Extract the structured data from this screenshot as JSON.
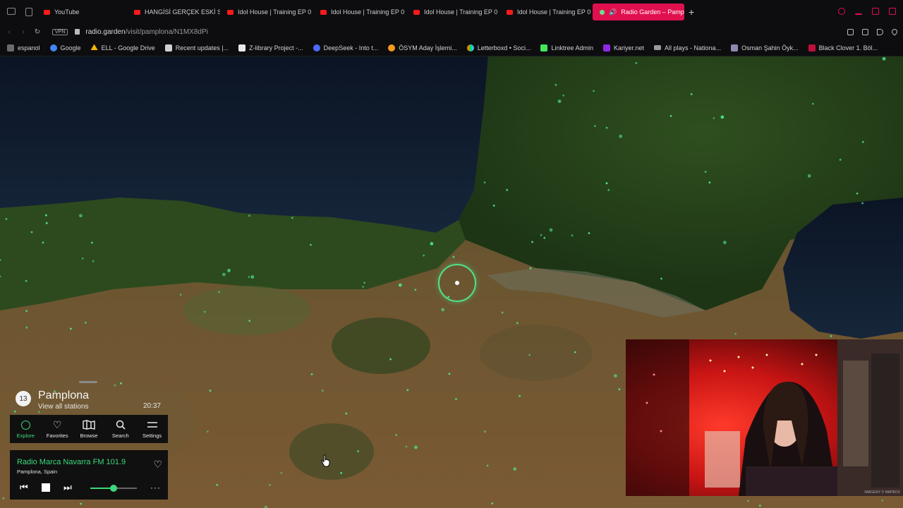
{
  "browser": {
    "tabs": [
      {
        "label": "YouTube",
        "icon": "youtube-icon"
      },
      {
        "label": "HANGİSİ GERÇEK ESKİ SE",
        "icon": "youtube-icon"
      },
      {
        "label": "Idol House | Training EP 0",
        "icon": "youtube-icon"
      },
      {
        "label": "Idol House | Training EP 0",
        "icon": "youtube-icon"
      },
      {
        "label": "Idol House | Training EP 0",
        "icon": "youtube-icon"
      },
      {
        "label": "Idol House | Training EP 0",
        "icon": "youtube-icon"
      },
      {
        "label": "Radio Garden – Pampl",
        "icon": "radio-garden-icon",
        "active": true
      }
    ],
    "vpn_label": "VPN",
    "url_host": "radio.garden",
    "url_path": "/visit/pamplona/N1MX8dPi",
    "bookmarks": [
      {
        "label": "espanol",
        "color": "#6b6b6b"
      },
      {
        "label": "Google",
        "color": "#4285f4"
      },
      {
        "label": "ELL - Google Drive",
        "color": "#f4b400"
      },
      {
        "label": "Recent updates |...",
        "color": "#d0d0d0"
      },
      {
        "label": "Z-library Project -...",
        "color": "#e9e9e9"
      },
      {
        "label": "DeepSeek - Into t...",
        "color": "#4d6bfe"
      },
      {
        "label": "ÖSYM Aday İşlemi...",
        "color": "#f29b1d"
      },
      {
        "label": "Letterboxd • Soci...",
        "color": "#40bcf4"
      },
      {
        "label": "Linktree Admin",
        "color": "#43e55e"
      },
      {
        "label": "Kariyer.net",
        "color": "#8a2be2"
      },
      {
        "label": "All plays - Nationa...",
        "color": "#9a9a9a"
      },
      {
        "label": "Osman Şahin Öyk...",
        "color": "#8a8ab0"
      },
      {
        "label": "Black Clover 1. Böl...",
        "color": "#c0103a"
      }
    ]
  },
  "radio_panel": {
    "station_count": "13",
    "location_name": "Pamplona",
    "view_all_label": "View all stations",
    "local_time": "20:37",
    "nav": [
      {
        "label": "Explore",
        "icon": "explore-ring-icon",
        "active": true
      },
      {
        "label": "Favorites",
        "icon": "heart-icon"
      },
      {
        "label": "Browse",
        "icon": "map-book-icon"
      },
      {
        "label": "Search",
        "icon": "search-icon"
      },
      {
        "label": "Settings",
        "icon": "menu-lines-icon"
      }
    ],
    "player": {
      "station_name": "Radio Marca Navarra FM 101.9",
      "station_location": "Pamplona, Spain",
      "volume_fraction": 0.5
    }
  },
  "map": {
    "attribution": "IMAGERY © MAPBOX"
  },
  "colors": {
    "accent_green": "#3cd97b",
    "active_tab": "#e0104e",
    "webcam_red": "#c81414"
  }
}
